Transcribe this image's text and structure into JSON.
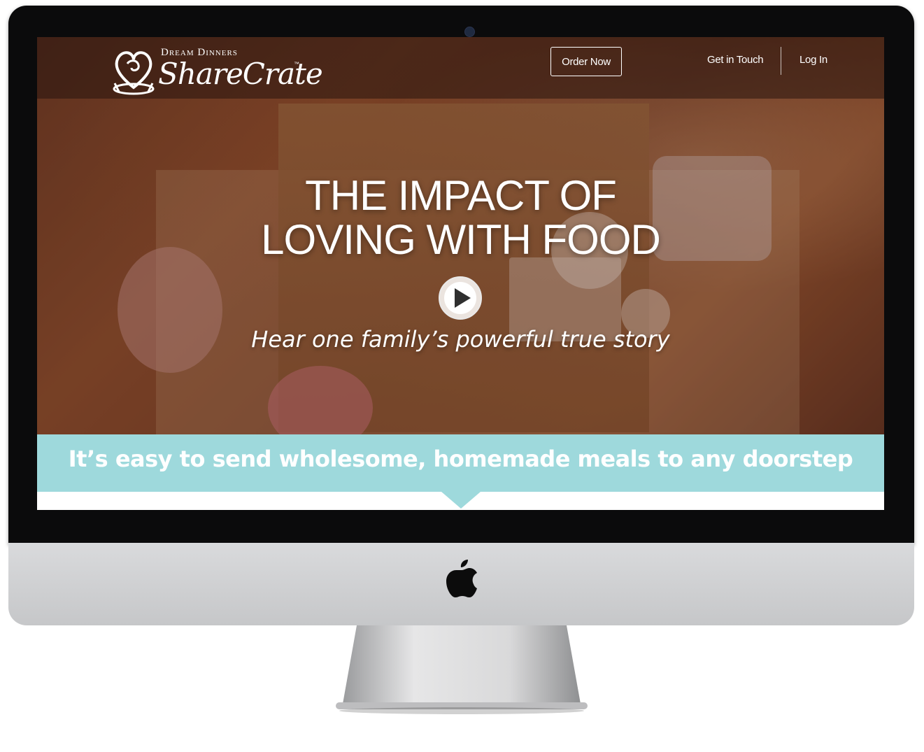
{
  "brand": {
    "parent": "Dream Dinners",
    "name": "ShareCrate",
    "tm": "™"
  },
  "nav": {
    "order_now": "Order Now",
    "get_in_touch": "Get in Touch",
    "log_in": "Log In"
  },
  "hero": {
    "headline_line1": "THE IMPACT OF",
    "headline_line2": "LOVING WITH FOOD",
    "subline": "Hear one family’s powerful true story"
  },
  "band": {
    "text": "It’s easy to send wholesome, homemade meals to any doorstep"
  },
  "colors": {
    "band": "#9ed9dc",
    "bezel": "#0b0b0c",
    "chin": "#d0d1d3"
  },
  "icons": {
    "play": "play-icon",
    "apple": "apple-logo-icon",
    "brand_mark": "heart-crate-logo-icon"
  }
}
